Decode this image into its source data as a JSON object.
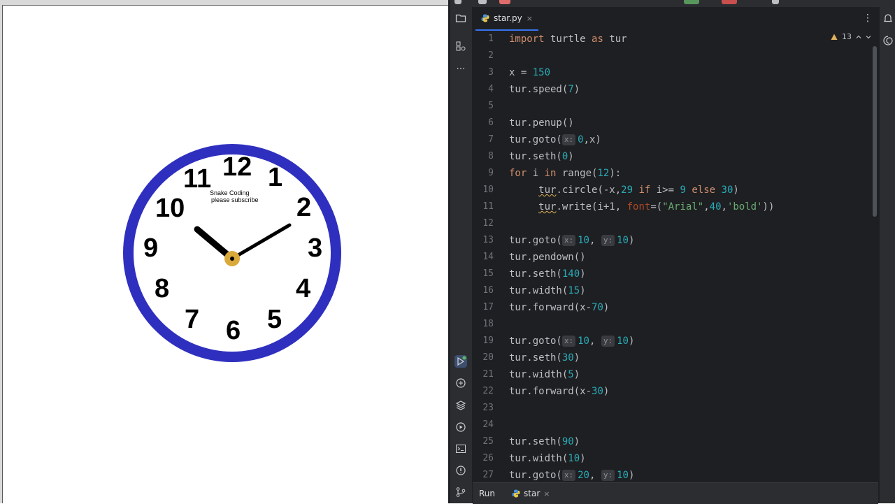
{
  "turtle_window": {
    "clock": {
      "numbers": [
        "12",
        "1",
        "2",
        "3",
        "4",
        "5",
        "6",
        "7",
        "8",
        "9",
        "10",
        "11"
      ],
      "watermark_line1": "Snake Coding",
      "watermark_line2": "please subscribe",
      "ring_color": "#2f2fbf",
      "center_color": "#d9a93a",
      "hand_color": "#000000"
    }
  },
  "ide": {
    "toolstrip_icons": [
      "folder-icon",
      "structure-icon",
      "more-icon",
      "run-icon",
      "python-console-icon",
      "layers-icon",
      "services-icon",
      "terminal-icon",
      "problems-icon",
      "git-icon"
    ],
    "right_icons": [
      "notifications-icon",
      "ai-assistant-icon"
    ],
    "tab": {
      "label": "star.py",
      "close": "×",
      "menu": "⋮"
    },
    "inspection": {
      "count": "13"
    },
    "line_numbers": [
      "1",
      "2",
      "3",
      "4",
      "5",
      "6",
      "7",
      "8",
      "9",
      "10",
      "11",
      "12",
      "13",
      "14",
      "15",
      "16",
      "17",
      "18",
      "19",
      "20",
      "21",
      "22",
      "23",
      "24",
      "25",
      "26",
      "27"
    ],
    "code": {
      "l1_kw1": "import",
      "l1_mid": " turtle ",
      "l1_kw2": "as",
      "l1_end": " tur",
      "l3_pre": "x = ",
      "l3_num": "150",
      "l4_pre": "tur.speed(",
      "l4_num": "7",
      "l4_end": ")",
      "l6": "tur.penup()",
      "l7_pre": "tur.goto(",
      "l7_hint": "x:",
      "l7_num": "0",
      "l7_end": ",x)",
      "l8_pre": "tur.seth(",
      "l8_num": "0",
      "l8_end": ")",
      "l9_kw1": "for",
      "l9_mid1": " i ",
      "l9_kw2": "in",
      "l9_mid2": " range(",
      "l9_num": "12",
      "l9_end": "):",
      "l10_indent": "     ",
      "l10_tur": "tur",
      "l10_a": ".circle(-x,",
      "l10_n1": "29",
      "l10_sp": " ",
      "l10_kw1": "if",
      "l10_b": " i>= ",
      "l10_n2": "9",
      "l10_sp2": " ",
      "l10_kw2": "else",
      "l10_sp3": " ",
      "l10_n3": "30",
      "l10_end": ")",
      "l11_indent": "     ",
      "l11_tur": "tur",
      "l11_a": ".write(i+1, ",
      "l11_arg": "font",
      "l11_b": "=(",
      "l11_s1": "\"Arial\"",
      "l11_c": ",",
      "l11_n": "40",
      "l11_d": ",",
      "l11_s2": "'bold'",
      "l11_end": "))",
      "l13_pre": "tur.goto(",
      "l13_hx": "x:",
      "l13_n1": "10",
      "l13_c": ", ",
      "l13_hy": "y:",
      "l13_n2": "10",
      "l13_end": ")",
      "l14": "tur.pendown()",
      "l15_pre": "tur.seth(",
      "l15_num": "140",
      "l15_end": ")",
      "l16_pre": "tur.width(",
      "l16_num": "15",
      "l16_end": ")",
      "l17_pre": "tur.forward(x-",
      "l17_num": "70",
      "l17_end": ")",
      "l19_pre": "tur.goto(",
      "l19_hx": "x:",
      "l19_n1": "10",
      "l19_c": ", ",
      "l19_hy": "y:",
      "l19_n2": "10",
      "l19_end": ")",
      "l20_pre": "tur.seth(",
      "l20_num": "30",
      "l20_end": ")",
      "l21_pre": "tur.width(",
      "l21_num": "5",
      "l21_end": ")",
      "l22_pre": "tur.forward(x-",
      "l22_num": "30",
      "l22_end": ")",
      "l25_pre": "tur.seth(",
      "l25_num": "90",
      "l25_end": ")",
      "l26_pre": "tur.width(",
      "l26_num": "10",
      "l26_end": ")",
      "l27_pre": "tur.goto(",
      "l27_hx": "x:",
      "l27_n1": "20",
      "l27_c": ", ",
      "l27_hy": "y:",
      "l27_n2": "10",
      "l27_end": ")"
    },
    "bottom": {
      "run_label": "Run",
      "run_tab_label": "star",
      "run_tab_close": "×"
    }
  }
}
